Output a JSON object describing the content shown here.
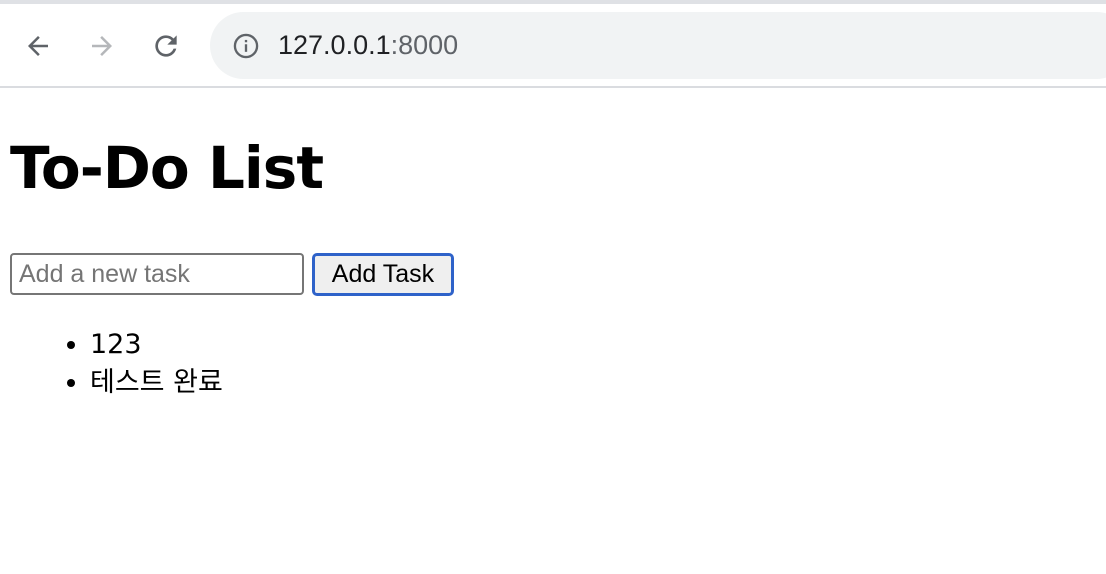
{
  "browser": {
    "url_host": "127.0.0.1",
    "url_port": ":8000",
    "icons": {
      "back": "back-arrow-icon",
      "forward": "forward-arrow-icon",
      "reload": "reload-icon",
      "site_info": "info-icon"
    }
  },
  "page": {
    "title": "To-Do List",
    "input": {
      "placeholder": "Add a new task",
      "value": ""
    },
    "add_button_label": "Add Task",
    "tasks": [
      {
        "text": "123"
      },
      {
        "text": "테스트 완료"
      }
    ]
  }
}
